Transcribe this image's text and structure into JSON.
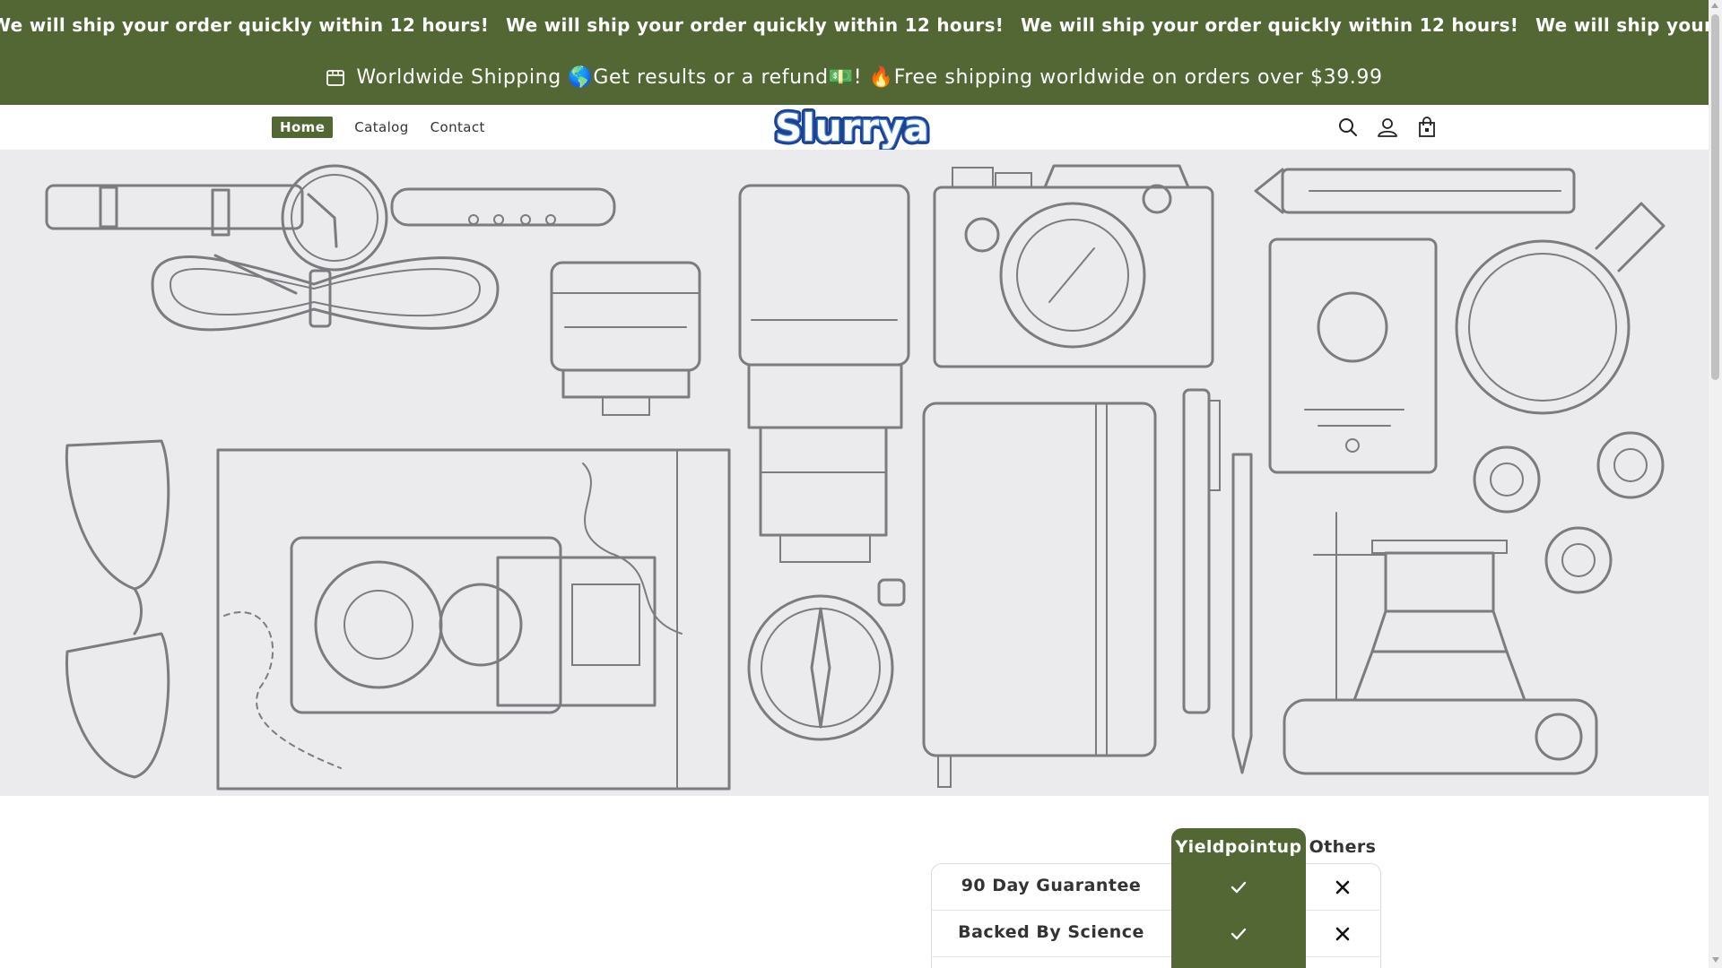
{
  "ticker": {
    "messages": [
      "We will ship your order quickly within 12 hours!",
      "We will ship your order quickly within 12 hours!",
      "We will ship your order quickly within 12 hours!",
      "We will ship your order quickly within 12 hours!"
    ]
  },
  "announcement": {
    "icon": "store-icon",
    "text": "Worldwide Shipping 🌎Get results or a refund💵! 🔥Free shipping worldwide on orders over $39.99"
  },
  "nav": {
    "items": [
      {
        "label": "Home",
        "active": true
      },
      {
        "label": "Catalog",
        "active": false
      },
      {
        "label": "Contact",
        "active": false
      }
    ]
  },
  "logo": {
    "text": "Slurrya"
  },
  "header_icons": [
    "search-icon",
    "account-icon",
    "cart-icon"
  ],
  "colors": {
    "brand": "#526734",
    "hero_bg": "#ebebee",
    "line_art": "#7b7b80"
  },
  "comparison": {
    "brand_column": "Yieldpointup",
    "other_column": "Others",
    "rows": [
      {
        "label": "90 Day Guarantee",
        "brand": "check",
        "others": "cross"
      },
      {
        "label": "Backed By Science",
        "brand": "check",
        "others": "cross"
      }
    ]
  }
}
